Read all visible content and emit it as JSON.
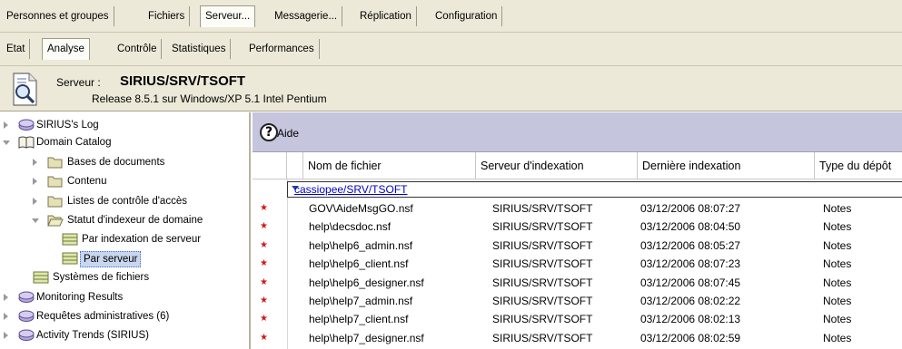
{
  "top_tabs": [
    "Personnes et groupes",
    "Fichiers",
    "Serveur...",
    "Messagerie...",
    "Réplication",
    "Configuration"
  ],
  "sub_tabs": [
    "Etat",
    "Analyse",
    "Contrôle",
    "Statistiques",
    "Performances"
  ],
  "server": {
    "label": "Serveur :",
    "name": "SIRIUS/SRV/TSOFT",
    "release": "Release 8.5.1 sur Windows/XP 5.1 Intel Pentium"
  },
  "tree": [
    {
      "label": "SIRIUS's Log"
    },
    {
      "label": "Domain Catalog"
    },
    {
      "label": "Bases de documents"
    },
    {
      "label": "Contenu"
    },
    {
      "label": "Listes de contrôle d'accès"
    },
    {
      "label": "Statut d'indexeur de domaine"
    },
    {
      "label": "Par indexation de serveur"
    },
    {
      "label": "Par serveur"
    },
    {
      "label": "Systèmes de fichiers"
    },
    {
      "label": "Monitoring Results"
    },
    {
      "label": "Requêtes administratives (6)"
    },
    {
      "label": "Activity Trends (SIRIUS)"
    }
  ],
  "toolbar": {
    "help_label": "Aide"
  },
  "table": {
    "columns": [
      "Nom de fichier",
      "Serveur d'indexation",
      "Dernière indexation",
      "Type du dépôt"
    ],
    "category": "cassiopee/SRV/TSOFT",
    "rows": [
      [
        "GOV\\AideMsgGO.nsf",
        "SIRIUS/SRV/TSOFT",
        "03/12/2006 08:07:27",
        "Notes"
      ],
      [
        "help\\decsdoc.nsf",
        "SIRIUS/SRV/TSOFT",
        "03/12/2006 08:04:50",
        "Notes"
      ],
      [
        "help\\help6_admin.nsf",
        "SIRIUS/SRV/TSOFT",
        "03/12/2006 08:05:27",
        "Notes"
      ],
      [
        "help\\help6_client.nsf",
        "SIRIUS/SRV/TSOFT",
        "03/12/2006 08:07:23",
        "Notes"
      ],
      [
        "help\\help6_designer.nsf",
        "SIRIUS/SRV/TSOFT",
        "03/12/2006 08:07:45",
        "Notes"
      ],
      [
        "help\\help7_admin.nsf",
        "SIRIUS/SRV/TSOFT",
        "03/12/2006 08:02:22",
        "Notes"
      ],
      [
        "help\\help7_client.nsf",
        "SIRIUS/SRV/TSOFT",
        "03/12/2006 08:02:13",
        "Notes"
      ],
      [
        "help\\help7_designer.nsf",
        "SIRIUS/SRV/TSOFT",
        "03/12/2006 08:02:59",
        "Notes"
      ]
    ]
  },
  "colors": {
    "accent_bar": "#c5c5de",
    "selection": "#3d6fcf",
    "unread_star": "#d01818",
    "link": "#0000c8"
  }
}
